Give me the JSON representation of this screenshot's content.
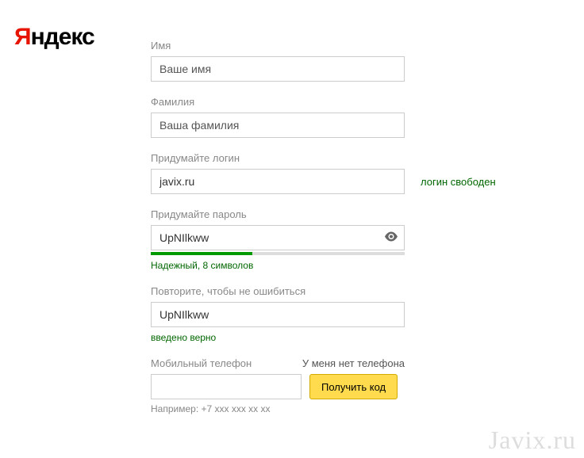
{
  "logo": {
    "accent": "Я",
    "rest": "ндекс"
  },
  "form": {
    "first_name": {
      "label": "Имя",
      "placeholder": "Ваше имя",
      "value": ""
    },
    "last_name": {
      "label": "Фамилия",
      "placeholder": "Ваша фамилия",
      "value": ""
    },
    "login": {
      "label": "Придумайте логин",
      "value": "javix.ru",
      "status": "логин свободен"
    },
    "password": {
      "label": "Придумайте пароль",
      "value": "UpNIlkww",
      "strength_text": "Надежный, 8 символов",
      "strength_percent": 40
    },
    "password_repeat": {
      "label": "Повторите, чтобы не ошибиться",
      "value": "UpNIlkww",
      "status": "введено верно"
    },
    "phone": {
      "label": "Мобильный телефон",
      "no_phone": "У меня нет телефона",
      "value": "",
      "button": "Получить код",
      "hint": "Например: +7 xxx xxx xx xx"
    }
  },
  "watermark": "Javix.ru"
}
